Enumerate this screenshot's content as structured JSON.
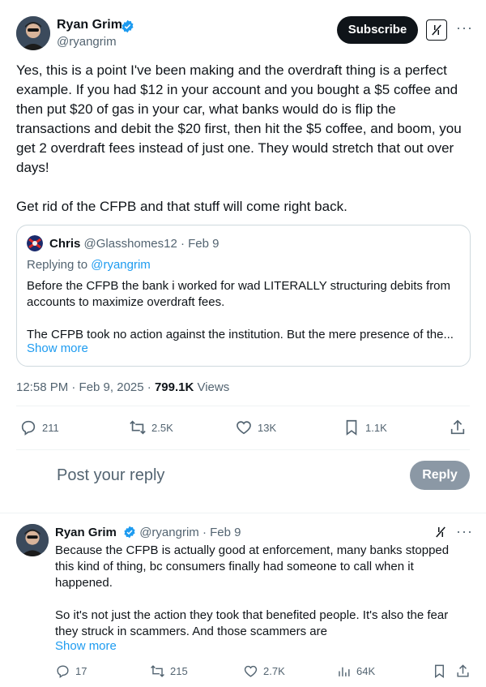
{
  "main_tweet": {
    "author_name": "Ryan Grim",
    "author_handle": "@ryangrim",
    "subscribe_label": "Subscribe",
    "body": "Yes, this is a point I've been making and the overdraft thing is a perfect example. If you had $12 in your account and you bought a $5 coffee and then put $20 of gas in your car, what banks would do is flip the transactions and debit the $20 first, then hit the $5 coffee, and boom, you get 2 overdraft fees instead of just one. They would stretch that out over days!\n\nGet rid of the CFPB and that stuff will come right back.",
    "quote": {
      "author_name": "Chris",
      "author_handle": "@Glasshomes12",
      "date": "· Feb 9",
      "replying_prefix": "Replying to ",
      "replying_to": "@ryangrim",
      "body": "Before the CFPB the bank i worked for wad LITERALLY structuring debits from accounts to maximize overdraft fees.\n\nThe CFPB took no action against the institution. But the mere presence of the...",
      "show_more": "Show more"
    },
    "time": "12:58 PM · Feb 9, 2025 · ",
    "views_count": "799.1K",
    "views_label": " Views",
    "stats": {
      "replies": "211",
      "reposts": "2.5K",
      "likes": "13K",
      "bookmarks": "1.1K"
    }
  },
  "reply_box": {
    "placeholder": "Post your reply",
    "button_label": "Reply"
  },
  "reply_tweet": {
    "author_name": "Ryan Grim",
    "author_handle": "@ryangrim",
    "date": "· Feb 9",
    "body": "Because the CFPB is actually good at enforcement, many banks stopped this kind of thing, bc consumers finally had someone to call when it happened.\n\nSo it's not just the action they took that benefited people. It's also the fear they struck in scammers. And those scammers are",
    "show_more": "Show more",
    "stats": {
      "replies": "17",
      "reposts": "215",
      "likes": "2.7K",
      "views": "64K"
    }
  },
  "colors": {
    "accent": "#1d9bf0",
    "text": "#0f1419",
    "muted": "#536471",
    "verified": "#1d9bf0"
  },
  "icons": [
    "verified-badge-icon",
    "grok-icon",
    "more-icon",
    "reply-icon",
    "repost-icon",
    "like-icon",
    "bookmark-icon",
    "share-icon",
    "views-icon"
  ]
}
